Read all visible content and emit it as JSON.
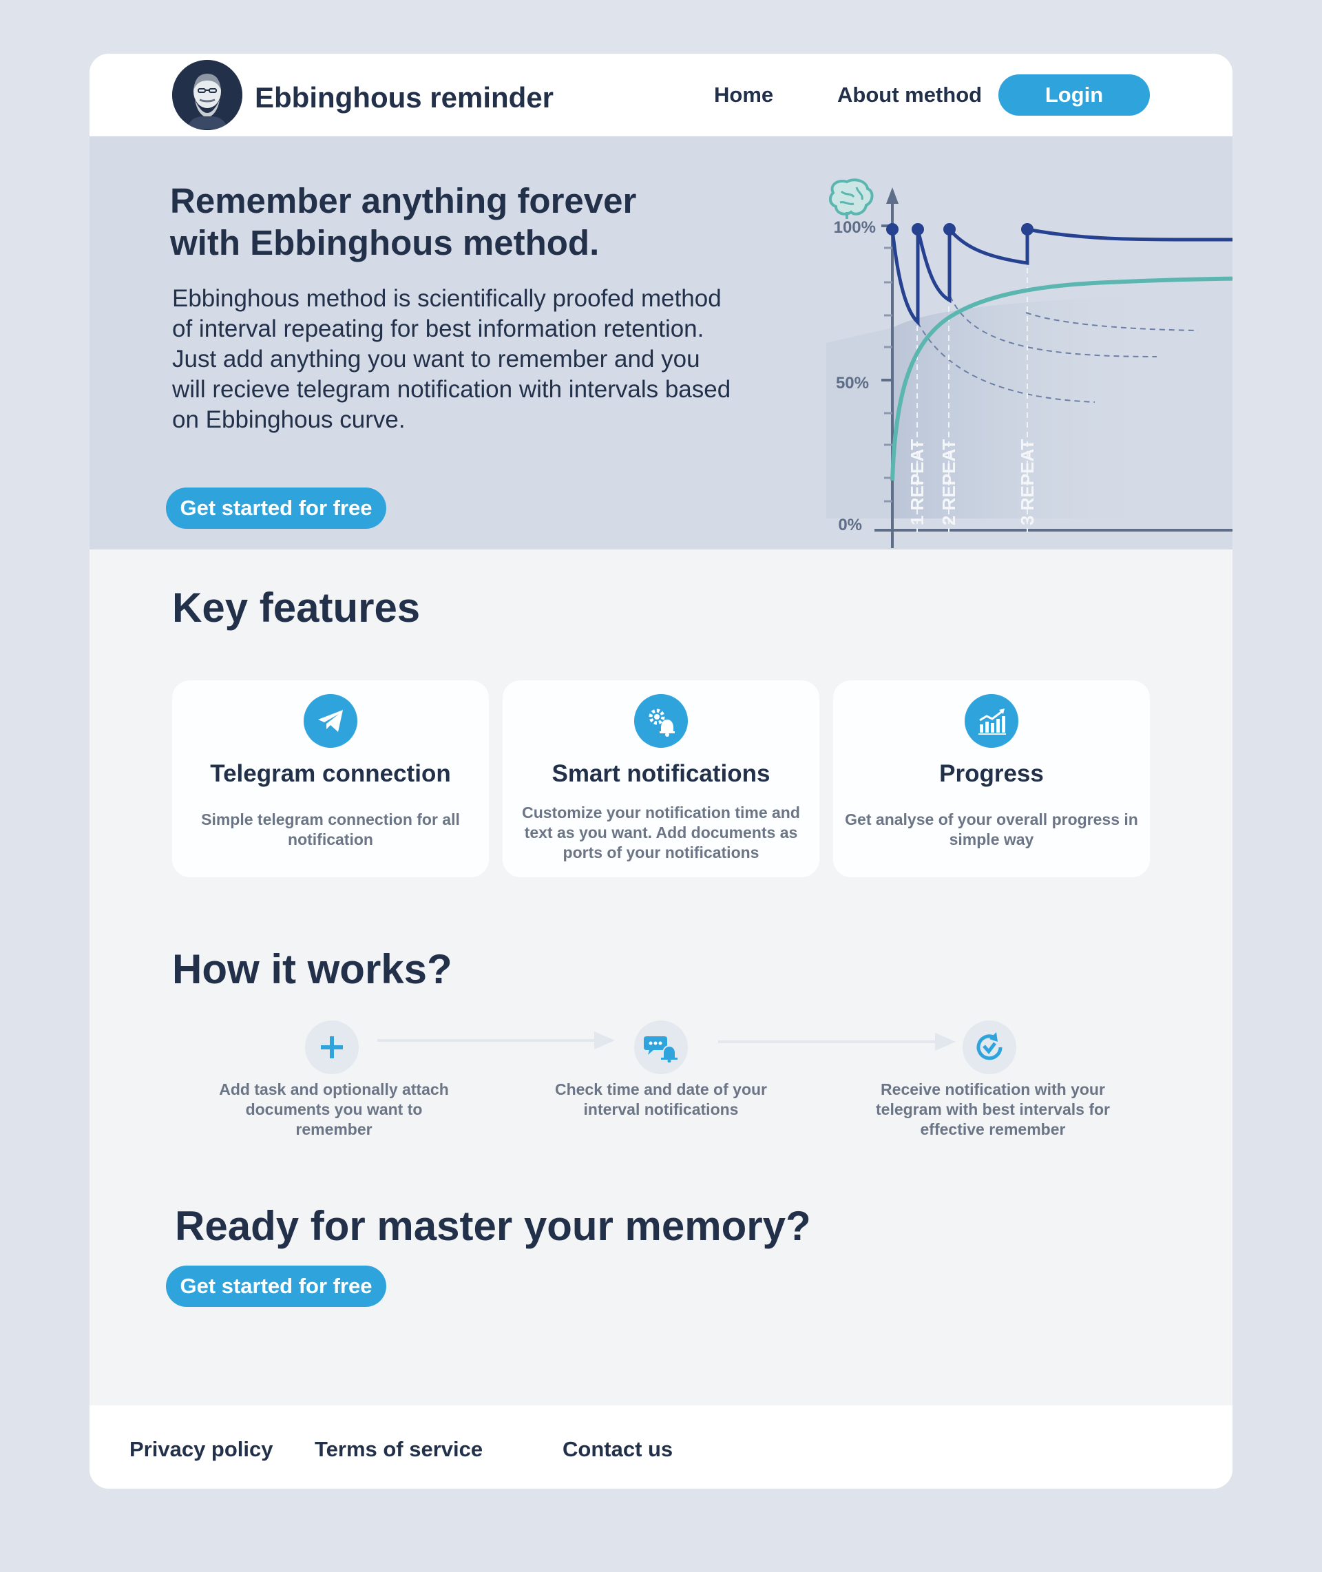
{
  "header": {
    "brand": "Ebbinghous reminder",
    "nav": {
      "home": "Home",
      "about": "About method",
      "login": "Login"
    }
  },
  "hero": {
    "title": "Remember anything forever with Ebbinghous method.",
    "description": "Ebbinghous method is scientifically proofed method of interval repeating for best information retention.\nJust add anything you want to remember and you will recieve telegram notification with intervals based on Ebbinghous curve.",
    "cta": "Get started for free",
    "chart": {
      "y_ticks": [
        "100%",
        "50%",
        "0%"
      ],
      "repeat_labels": [
        "1 REPEAT",
        "2 REPEAT",
        "3 REPEAT"
      ],
      "colors": {
        "primary": "#26418f",
        "accent": "#5bb6b0",
        "axis": "#5e6e88"
      }
    }
  },
  "features": {
    "title": "Key features",
    "cards": [
      {
        "icon": "telegram-plane-icon",
        "title": "Telegram connection",
        "text": "Simple telegram connection for all notification"
      },
      {
        "icon": "gear-bell-icon",
        "title": "Smart notifications",
        "text": "Customize your notification time and text as you want. Add documents as ports of your notifications"
      },
      {
        "icon": "bar-chart-growth-icon",
        "title": "Progress",
        "text": "Get analyse of your overall  progress in simple way"
      }
    ]
  },
  "how": {
    "title": "How it works?",
    "steps": [
      {
        "icon": "plus-icon",
        "text": "Add task and optionally attach documents you want to remember"
      },
      {
        "icon": "chat-bell-icon",
        "text": "Check time and date of your interval notifications"
      },
      {
        "icon": "refresh-check-icon",
        "text": "Receive notification with your telegram with best intervals for effective remember"
      }
    ]
  },
  "ready": {
    "title": "Ready for master your memory?",
    "cta": "Get started for free"
  },
  "footer": {
    "privacy": "Privacy policy",
    "terms": "Terms of service",
    "contact": "Contact us"
  },
  "colors": {
    "accent": "#2fa3dc",
    "text": "#22304a",
    "muted": "#6b7585",
    "hero_bg": "#d4dbe6"
  }
}
